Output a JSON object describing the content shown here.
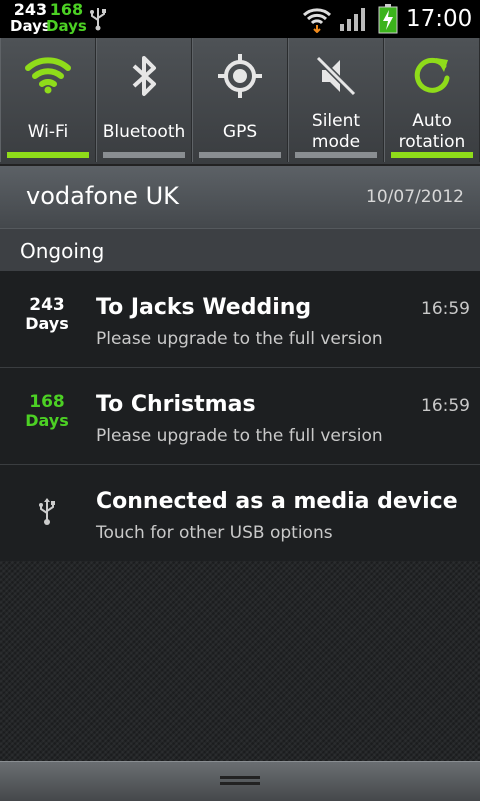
{
  "status_bar": {
    "counter1": {
      "number": "243",
      "label": "Days",
      "color": "#ffffff"
    },
    "counter2": {
      "number": "168",
      "label": "Days",
      "color": "#4cd024"
    },
    "icons": [
      "usb-icon",
      "wifi-icon",
      "signal-icon",
      "battery-charging-icon"
    ],
    "time": "17:00"
  },
  "quick_settings": [
    {
      "label": "Wi-Fi",
      "icon": "wifi-icon",
      "enabled": true
    },
    {
      "label": "Bluetooth",
      "icon": "bluetooth-icon",
      "enabled": false
    },
    {
      "label": "GPS",
      "icon": "gps-icon",
      "enabled": false
    },
    {
      "label": "Silent\nmode",
      "icon": "silent-mode-icon",
      "enabled": false
    },
    {
      "label": "Auto\nrotation",
      "icon": "auto-rotation-icon",
      "enabled": true
    }
  ],
  "carrier": {
    "name": "vodafone UK",
    "date": "10/07/2012"
  },
  "ongoing": {
    "label": "Ongoing"
  },
  "notifications": [
    {
      "icon_number": "243",
      "icon_label": "Days",
      "icon_color": "#ffffff",
      "title": "To Jacks Wedding",
      "subtitle": "Please upgrade to the full version",
      "time": "16:59"
    },
    {
      "icon_number": "168",
      "icon_label": "Days",
      "icon_color": "#4cd024",
      "title": "To Christmas",
      "subtitle": "Please upgrade to the full version",
      "time": "16:59"
    },
    {
      "icon": "usb-icon",
      "title": "Connected as a media device",
      "subtitle": "Touch for other USB options",
      "time": ""
    }
  ],
  "colors": {
    "accent": "#8fdc1a",
    "counter_green": "#4cd024"
  }
}
